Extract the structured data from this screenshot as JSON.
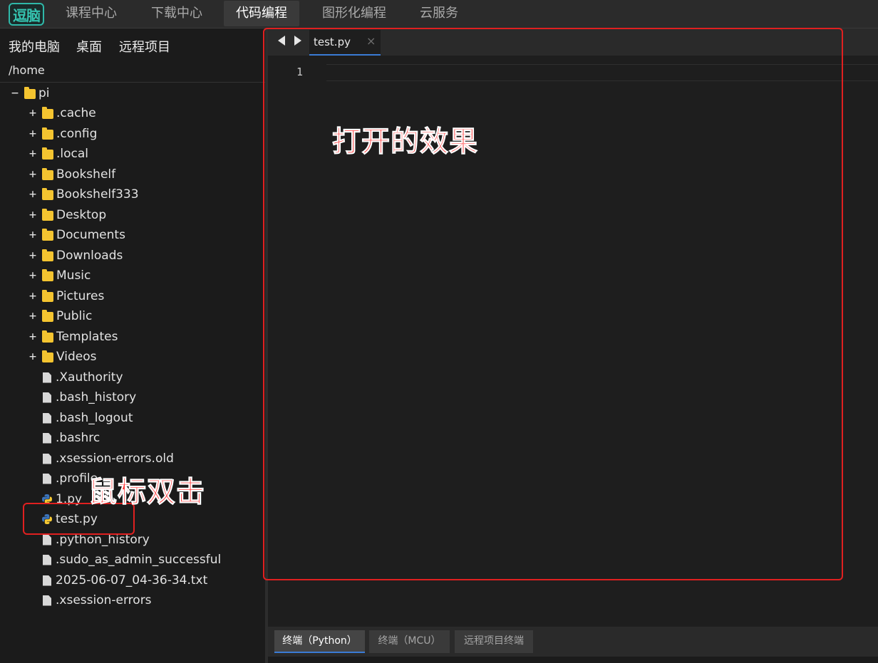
{
  "app": {
    "logo_text": "逗脑",
    "nav": [
      "课程中心",
      "下载中心",
      "代码编程",
      "图形化编程",
      "云服务"
    ],
    "active_nav": "代码编程"
  },
  "sidebar": {
    "location_tabs": [
      "我的电脑",
      "桌面",
      "远程项目"
    ],
    "path": "/home",
    "root": "pi",
    "folders": [
      ".cache",
      ".config",
      ".local",
      "Bookshelf",
      "Bookshelf333",
      "Desktop",
      "Documents",
      "Downloads",
      "Music",
      "Pictures",
      "Public",
      "Templates",
      "Videos"
    ],
    "files_before_py": [
      ".Xauthority",
      ".bash_history",
      ".bash_logout",
      ".bashrc",
      ".xsession-errors.old",
      ".profile"
    ],
    "py_files": [
      "1.py",
      "test.py"
    ],
    "files_after_py": [
      ".python_history",
      ".sudo_as_admin_successful",
      "2025-06-07_04-36-34.txt",
      ".xsession-errors"
    ]
  },
  "editor": {
    "tab_label": "test.py",
    "tab_close": "×",
    "line_numbers": [
      "1"
    ]
  },
  "terminal_tabs": [
    "终端（Python）",
    "终端（MCU）",
    "远程项目终端"
  ],
  "annotations": {
    "editor_note": "打开的效果",
    "file_note": "鼠标双击"
  },
  "colors": {
    "accent": "#3a7bd5",
    "folder": "#f4c430",
    "annotation": "#e02020"
  }
}
